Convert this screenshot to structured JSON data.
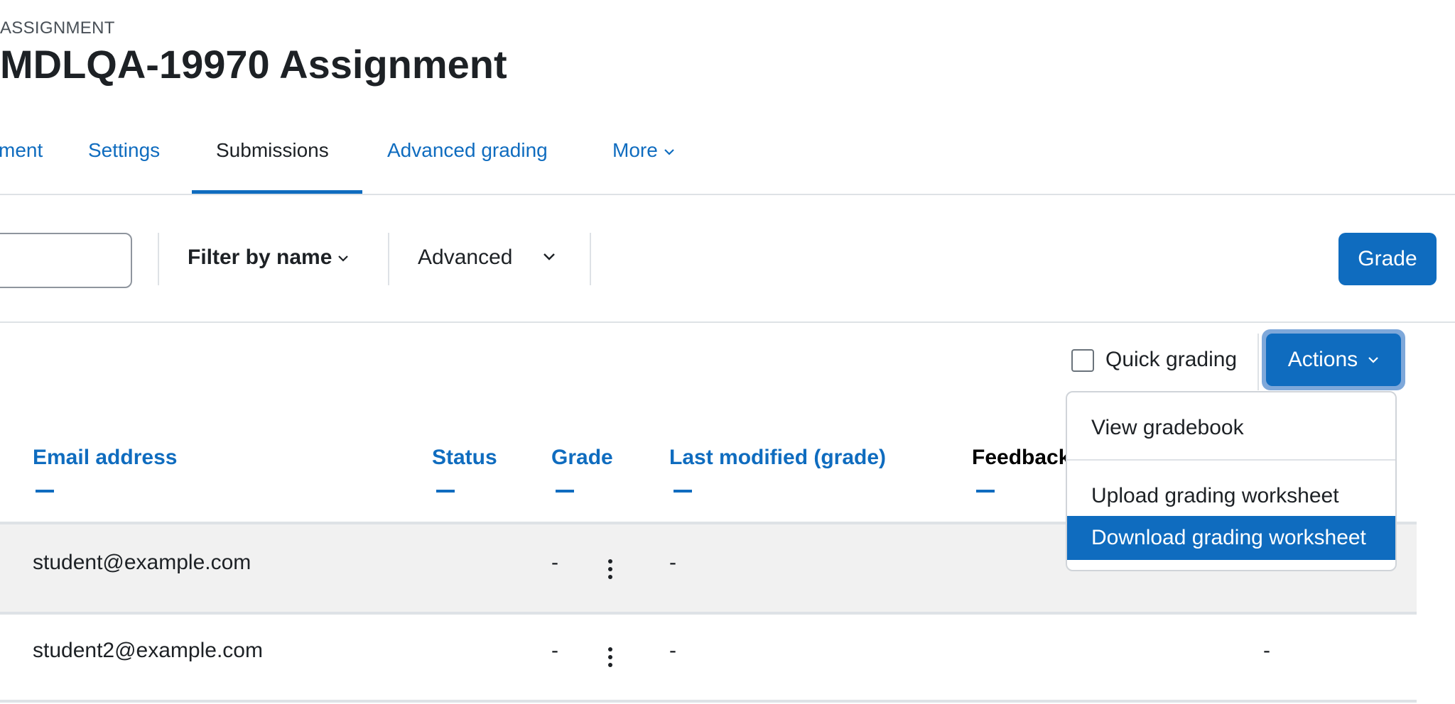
{
  "header": {
    "eyebrow": "ASSIGNMENT",
    "title": "MDLQA-19970 Assignment"
  },
  "tabs": [
    {
      "label": "ment"
    },
    {
      "label": "Settings"
    },
    {
      "label": "Submissions",
      "active": true
    },
    {
      "label": "Advanced grading"
    },
    {
      "label": "More"
    }
  ],
  "toolbar": {
    "search_value": "",
    "filter_label": "Filter by name",
    "advanced_label": "Advanced",
    "grade_label": "Grade"
  },
  "options": {
    "quick_grading_label": "Quick grading",
    "quick_grading_checked": false,
    "actions_label": "Actions"
  },
  "actions_menu": {
    "items": [
      {
        "label": "View gradebook"
      },
      {
        "label": "Upload grading worksheet"
      },
      {
        "label": "Download grading worksheet",
        "highlighted": true
      }
    ]
  },
  "table": {
    "columns": [
      "Email address",
      "Status",
      "Grade",
      "Last modified (grade)",
      "Feedback"
    ],
    "rows": [
      {
        "email": "student@example.com",
        "status": "",
        "grade": "-",
        "last_modified": "-",
        "feedback": ""
      },
      {
        "email": "student2@example.com",
        "status": "",
        "grade": "-",
        "last_modified": "-",
        "feedback": "-"
      }
    ]
  },
  "colors": {
    "primary": "#0f6cbf",
    "text": "#1d2125",
    "row_shade": "#f1f1f1",
    "focus_ring": "#7ea8da"
  }
}
